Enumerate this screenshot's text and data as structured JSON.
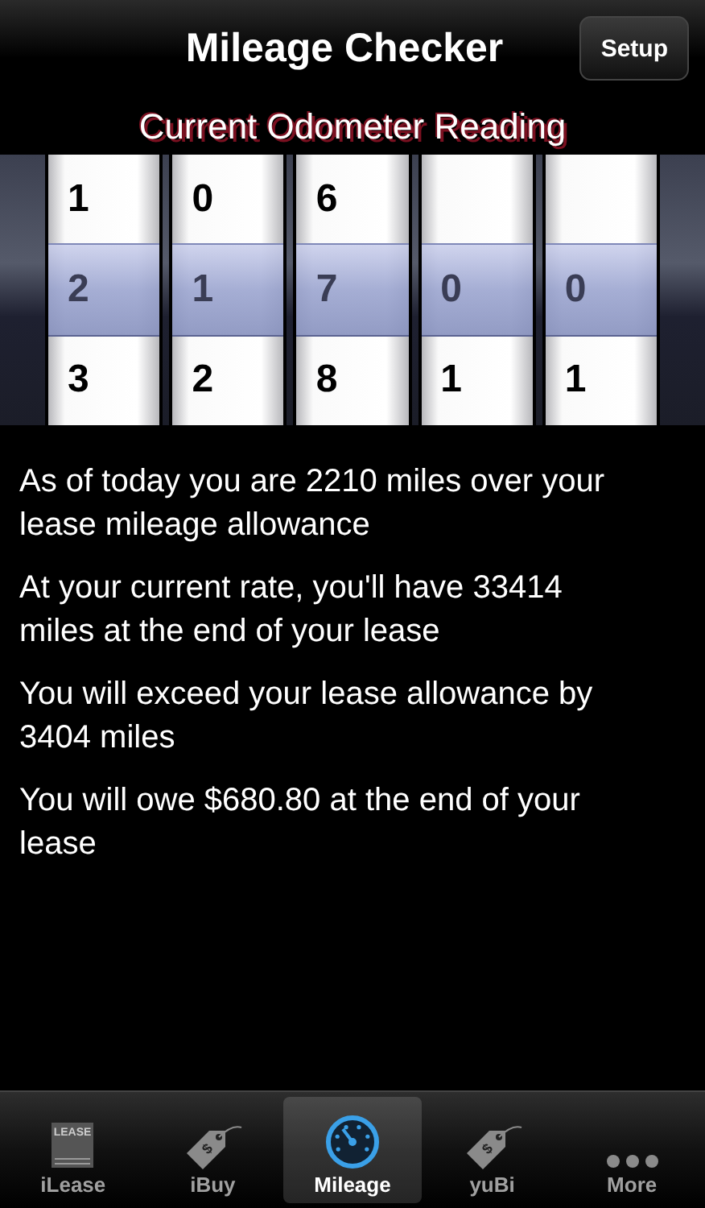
{
  "nav_bar": {
    "title": "Mileage Checker",
    "button": "Setup"
  },
  "heading": "Current Odometer Reading",
  "odometer": {
    "columns": [
      {
        "above": "1",
        "current": "2",
        "below": "3"
      },
      {
        "above": "0",
        "current": "1",
        "below": "2"
      },
      {
        "above": "6",
        "current": "7",
        "below": "8"
      },
      {
        "current": "0",
        "below": "1"
      },
      {
        "current": "0",
        "below": "1"
      }
    ]
  },
  "messages": [
    "As of today you are 2210 miles over your lease mileage allowance",
    "At your current rate, you'll have 33414 miles at the end of your lease",
    "You will exceed your lease allowance by 3404 miles",
    "You will owe $680.80 at the end of your lease"
  ],
  "tab_bar": [
    {
      "label": "iLease",
      "kind": "lease",
      "icon_text": "LEASE",
      "selected": false
    },
    {
      "label": "iBuy",
      "kind": "tag",
      "icon_text": "$",
      "selected": false
    },
    {
      "label": "Mileage",
      "kind": "gauge",
      "selected": true
    },
    {
      "label": "yuBi",
      "kind": "tag",
      "icon_text": "$",
      "selected": false
    },
    {
      "label": "More",
      "kind": "more",
      "selected": false
    }
  ]
}
